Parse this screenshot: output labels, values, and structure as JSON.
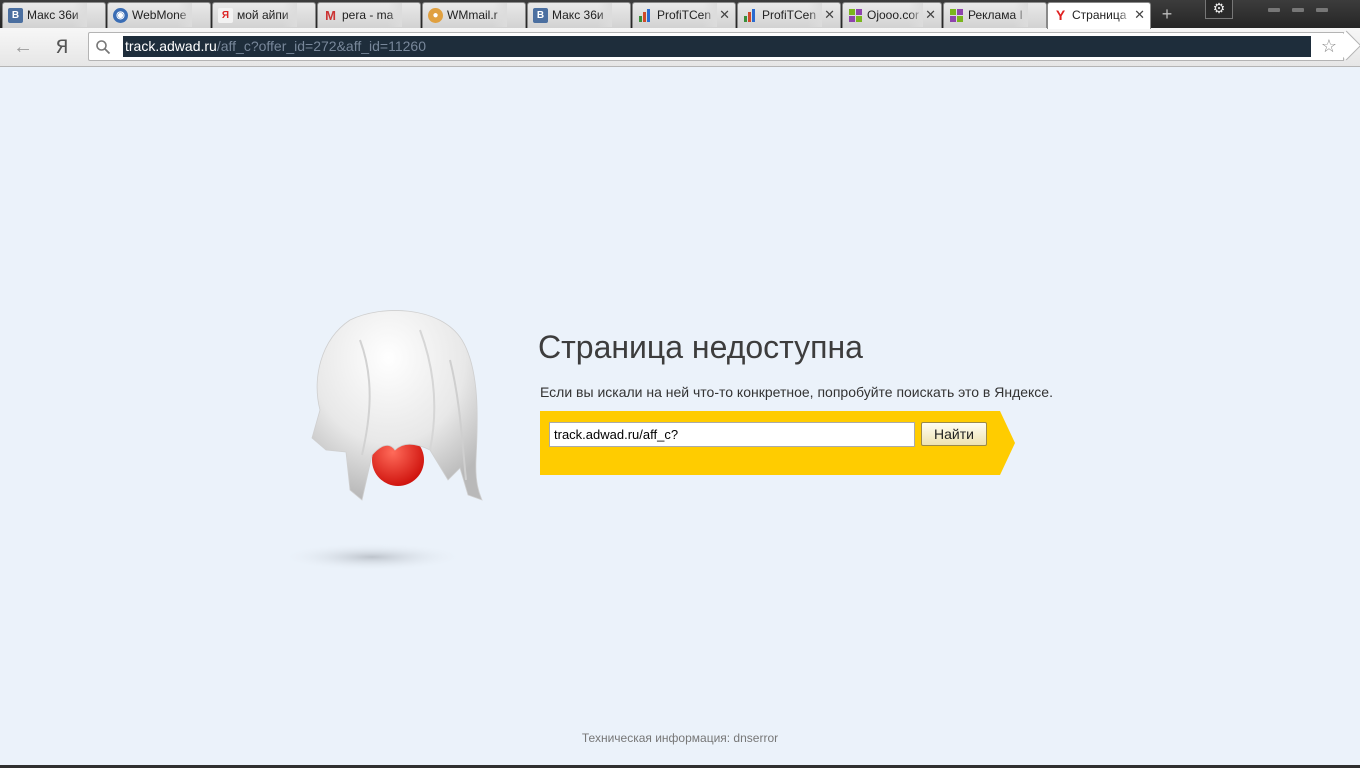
{
  "tabs": [
    {
      "title": "Макс 36и",
      "favicon": "vk-icon",
      "favicon_color": "#4b6fa0",
      "favicon_glyph": "В",
      "closable": false
    },
    {
      "title": "WebMone",
      "favicon": "webmoney-globe-icon",
      "favicon_color": "#3a6db5",
      "favicon_glyph": "◉",
      "closable": false
    },
    {
      "title": "мой айпи",
      "favicon": "yandex-icon",
      "favicon_color": "#e8e8e8",
      "favicon_glyph": "Я",
      "closable": false
    },
    {
      "title": "pera - ma",
      "favicon": "gmail-icon",
      "favicon_color": "#ffffff",
      "favicon_glyph": "M",
      "closable": false
    },
    {
      "title": "WMmail.r",
      "favicon": "wmmail-icon",
      "favicon_color": "#e0a040",
      "favicon_glyph": "●",
      "closable": false
    },
    {
      "title": "Макс 36и",
      "favicon": "vk-icon",
      "favicon_color": "#4b6fa0",
      "favicon_glyph": "В",
      "closable": false
    },
    {
      "title": "ProfiTCen",
      "favicon": "bar-chart-icon",
      "favicon_color": "#ffffff",
      "favicon_glyph": "▥",
      "closable": true
    },
    {
      "title": "ProfiTCen",
      "favicon": "bar-chart-icon",
      "favicon_color": "#ffffff",
      "favicon_glyph": "▥",
      "closable": true
    },
    {
      "title": "Ojooo.cor",
      "favicon": "ojooo-icon",
      "favicon_color": "#ffffff",
      "favicon_glyph": "▣",
      "closable": true
    },
    {
      "title": "Реклама I",
      "favicon": "ojooo-icon",
      "favicon_color": "#ffffff",
      "favicon_glyph": "▣",
      "closable": false
    },
    {
      "title": "Страница",
      "favicon": "yandex-browser-icon",
      "favicon_color": "#ffffff",
      "favicon_glyph": "Y",
      "closable": true,
      "active": true
    }
  ],
  "toolbar": {
    "url_host": "track.adwad.ru",
    "url_rest": "/aff_c?offer_id=272&aff_id=11260",
    "yandex_button": "Я"
  },
  "error_page": {
    "title": "Страница недоступна",
    "message": "Если вы искали на ней что-то конкретное, попробуйте поискать это в Яндексе.",
    "search_value": "track.adwad.ru/aff_c?",
    "search_button": "Найти",
    "tech_info": "Техническая информация: dnserror"
  },
  "colors": {
    "page_bg": "#ebf2fa",
    "search_band": "#ffcc00",
    "ghost_ball": "#e8221b"
  }
}
